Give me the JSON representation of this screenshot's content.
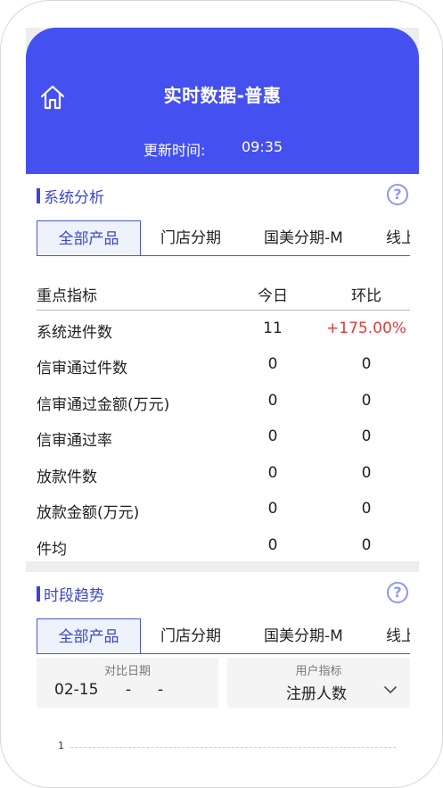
{
  "header": {
    "title": "实时数据-普惠",
    "update_label": "更新时间:",
    "update_time": "09:35"
  },
  "system_analysis": {
    "title": "系统分析",
    "tabs": [
      "全部产品",
      "门店分期",
      "国美分期-M",
      "线上"
    ],
    "columns": [
      "重点指标",
      "今日",
      "环比"
    ],
    "rows": [
      {
        "name": "系统进件数",
        "today": "11",
        "ratio": "+175.00%"
      },
      {
        "name": "信审通过件数",
        "today": "0",
        "ratio": "0"
      },
      {
        "name": "信审通过金额(万元)",
        "today": "0",
        "ratio": "0"
      },
      {
        "name": "信审通过率",
        "today": "0",
        "ratio": "0"
      },
      {
        "name": "放款件数",
        "today": "0",
        "ratio": "0"
      },
      {
        "name": "放款金额(万元)",
        "today": "0",
        "ratio": "0"
      },
      {
        "name": "件均",
        "today": "0",
        "ratio": "0"
      }
    ]
  },
  "period_trend": {
    "title": "时段趋势",
    "tabs": [
      "全部产品",
      "门店分期",
      "国美分期-M",
      "线上"
    ],
    "compare_date": {
      "label": "对比日期",
      "value": "02-15",
      "sep1": "-",
      "sep2": "-"
    },
    "user_metric": {
      "label": "用户指标",
      "value": "注册人数"
    },
    "chart_tick": "1"
  },
  "colors": {
    "header_bg": "#4550f0",
    "accent": "#3b47c9",
    "positive": "#e23b3b"
  },
  "icons": {
    "home": "home-icon",
    "help": "help-icon",
    "dropdown": "chevron-down-icon"
  }
}
